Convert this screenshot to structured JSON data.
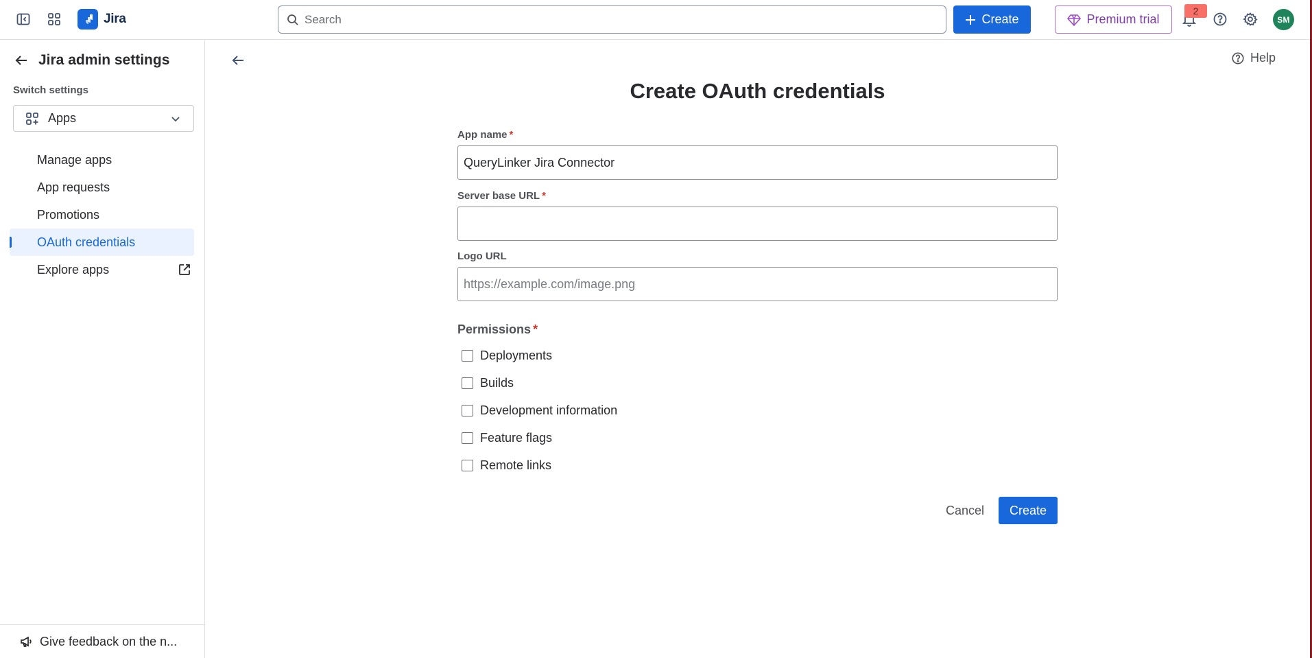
{
  "topnav": {
    "app_name": "Jira",
    "search_placeholder": "Search",
    "create_label": "Create",
    "premium_label": "Premium trial",
    "notification_count": "2",
    "avatar_initials": "SM",
    "icons": [
      "sidebar-toggle-icon",
      "app-switcher-icon",
      "jira-logo-icon",
      "search-icon",
      "plus-icon",
      "diamond-icon",
      "bell-icon",
      "help-icon",
      "gear-icon"
    ]
  },
  "sidebar": {
    "title": "Jira admin settings",
    "switch_label": "Switch settings",
    "switch_value": "Apps",
    "items": [
      {
        "label": "Manage apps",
        "active": false
      },
      {
        "label": "App requests",
        "active": false
      },
      {
        "label": "Promotions",
        "active": false
      },
      {
        "label": "OAuth credentials",
        "active": true
      },
      {
        "label": "Explore apps",
        "active": false,
        "external": true
      }
    ],
    "feedback_label": "Give feedback on the n..."
  },
  "main": {
    "help_label": "Help",
    "title": "Create OAuth credentials",
    "fields": {
      "app_name": {
        "label": "App name",
        "required_marker": "*",
        "value": "QueryLinker Jira Connector"
      },
      "server_base_url": {
        "label": "Server base URL",
        "required_marker": "*",
        "value": ""
      },
      "logo_url": {
        "label": "Logo URL",
        "placeholder": "https://example.com/image.png",
        "value": ""
      }
    },
    "permissions": {
      "label": "Permissions",
      "required_marker": "*",
      "options": [
        {
          "label": "Deployments",
          "checked": false
        },
        {
          "label": "Builds",
          "checked": false
        },
        {
          "label": "Development information",
          "checked": false
        },
        {
          "label": "Feature flags",
          "checked": false
        },
        {
          "label": "Remote links",
          "checked": false
        }
      ]
    },
    "cancel_label": "Cancel",
    "create_label": "Create"
  },
  "colors": {
    "brand_blue": "#1868db",
    "premium_purple": "#803fa5",
    "required_red": "#c9372c",
    "badge_red": "#f87168",
    "avatar_green": "#1f845a",
    "active_bg": "#e9f2fe"
  }
}
